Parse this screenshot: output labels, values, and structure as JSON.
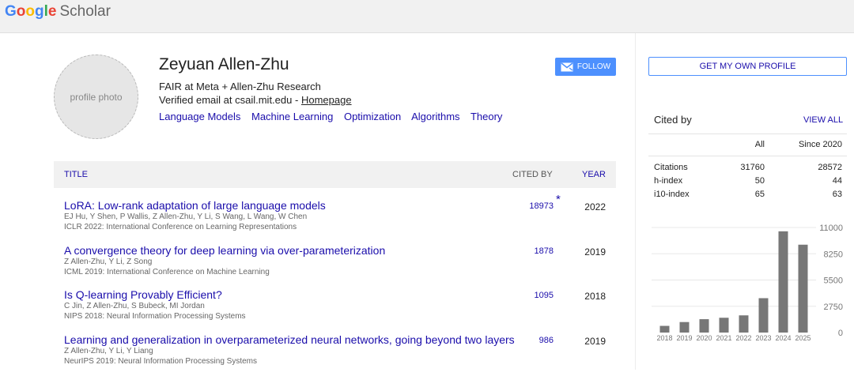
{
  "header": {
    "logo_letters": [
      "G",
      "o",
      "o",
      "g",
      "l",
      "e"
    ],
    "logo_colors": [
      "#4285f4",
      "#ea4335",
      "#fbbc05",
      "#4285f4",
      "#34a853",
      "#ea4335"
    ],
    "logo_product": "Scholar"
  },
  "profile": {
    "photo_label": "profile photo",
    "name": "Zeyuan Allen-Zhu",
    "affiliation": "FAIR at Meta + Allen-Zhu Research",
    "verified_email": "Verified email at csail.mit.edu",
    "separator": "-",
    "homepage_label": "Homepage",
    "interests": [
      "Language Models",
      "Machine Learning",
      "Optimization",
      "Algorithms",
      "Theory"
    ],
    "follow_label": "FOLLOW",
    "follow_icon": "mail-icon"
  },
  "table": {
    "col_title": "TITLE",
    "col_cited_by": "CITED BY",
    "col_year": "YEAR",
    "rows": [
      {
        "title": "LoRA: Low-rank adaptation of large language models",
        "authors": "EJ Hu, Y Shen, P Wallis, Z Allen-Zhu, Y Li, S Wang, L Wang, W Chen",
        "venue": "ICLR 2022: International Conference on Learning Representations",
        "cited_by": "18973",
        "star": "*",
        "year": "2022"
      },
      {
        "title": "A convergence theory for deep learning via over-parameterization",
        "authors": "Z Allen-Zhu, Y Li, Z Song",
        "venue": "ICML 2019: International Conference on Machine Learning",
        "cited_by": "1878",
        "star": "",
        "year": "2019"
      },
      {
        "title": "Is Q-learning Provably Efficient?",
        "authors": "C Jin, Z Allen-Zhu, S Bubeck, MI Jordan",
        "venue": "NIPS 2018: Neural Information Processing Systems",
        "cited_by": "1095",
        "star": "",
        "year": "2018"
      },
      {
        "title": "Learning and generalization in overparameterized neural networks, going beyond two layers",
        "authors": "Z Allen-Zhu, Y Li, Y Liang",
        "venue": "NeurIPS 2019: Neural Information Processing Systems",
        "cited_by": "986",
        "star": "",
        "year": "2019"
      }
    ]
  },
  "sidebar": {
    "get_profile_label": "GET MY OWN PROFILE",
    "cited_by_label": "Cited by",
    "view_all_label": "VIEW ALL",
    "col_all": "All",
    "col_since": "Since 2020",
    "metrics": [
      {
        "label": "Citations",
        "all": "31760",
        "since": "28572"
      },
      {
        "label": "h-index",
        "all": "50",
        "since": "44"
      },
      {
        "label": "i10-index",
        "all": "65",
        "since": "63"
      }
    ]
  },
  "chart_data": {
    "type": "bar",
    "categories": [
      "2018",
      "2019",
      "2020",
      "2021",
      "2022",
      "2023",
      "2024",
      "2025"
    ],
    "values": [
      700,
      1100,
      1400,
      1550,
      1800,
      3600,
      10600,
      9200
    ],
    "yticks": [
      0,
      2750,
      5500,
      8250,
      11000
    ],
    "ylim": [
      0,
      11000
    ],
    "bar_color": "#777777",
    "grid": true
  }
}
